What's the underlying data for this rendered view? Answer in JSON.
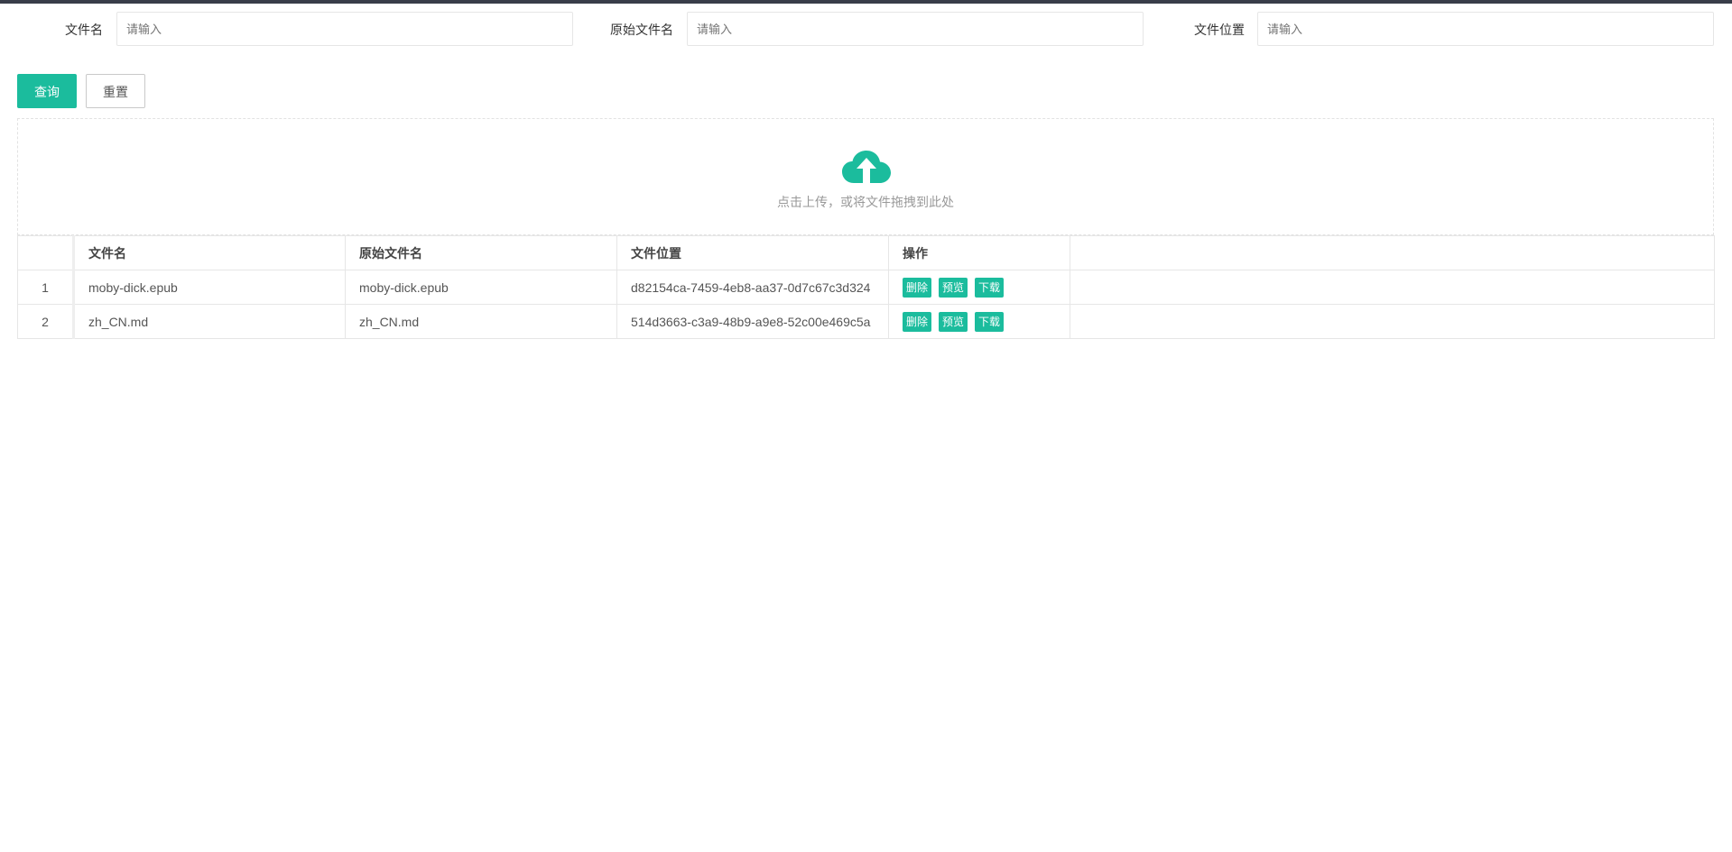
{
  "search": {
    "filename_label": "文件名",
    "filename_placeholder": "请输入",
    "original_label": "原始文件名",
    "original_placeholder": "请输入",
    "location_label": "文件位置",
    "location_placeholder": "请输入"
  },
  "buttons": {
    "query": "查询",
    "reset": "重置"
  },
  "upload": {
    "icon": "cloud-upload-icon",
    "text": "点击上传，或将文件拖拽到此处"
  },
  "table": {
    "headers": [
      "",
      "文件名",
      "原始文件名",
      "文件位置",
      "操作",
      ""
    ],
    "rows": [
      {
        "index": "1",
        "filename": "moby-dick.epub",
        "original": "moby-dick.epub",
        "location": "d82154ca-7459-4eb8-aa37-0d7c67c3d324",
        "actions": [
          "删除",
          "预览",
          "下载"
        ]
      },
      {
        "index": "2",
        "filename": "zh_CN.md",
        "original": "zh_CN.md",
        "location": "514d3663-c3a9-48b9-a9e8-52c00e469c5a",
        "actions": [
          "删除",
          "预览",
          "下载"
        ]
      }
    ]
  },
  "colors": {
    "accent": "#1bbc9d",
    "topbar": "#393d49"
  }
}
